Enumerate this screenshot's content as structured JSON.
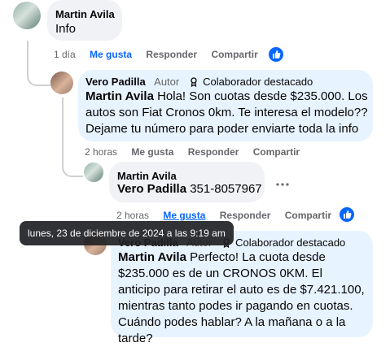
{
  "comments": [
    {
      "author": "Martin Avila",
      "text": "Info",
      "meta": {
        "time": "1 día",
        "like": "Me gusta",
        "reply": "Responder",
        "share": "Compartir"
      }
    },
    {
      "author": "Vero Padilla",
      "role": "Autor",
      "badge": "Colaborador destacado",
      "mention": "Martin Avila",
      "text": " Hola! Son cuotas desde $235.000. Los autos son Fiat Cronos 0km. Te interesa el modelo?? Dejame tu número para poder enviarte toda la info",
      "meta": {
        "time": "2 horas",
        "like": "Me gusta",
        "reply": "Responder",
        "share": "Compartir"
      }
    },
    {
      "author": "Martin Avila",
      "mention": "Vero Padilla",
      "text": " 351-8057967",
      "meta": {
        "time": "2 horas",
        "like": "Me gusta",
        "reply": "Responder",
        "share": "Compartir"
      }
    },
    {
      "author": "Vero Padilla",
      "role": "Autor",
      "badge": "Colaborador destacado",
      "mention": "Martin Avila",
      "text": " Perfecto! La cuota desde $235.000 es de un CRONOS 0KM. El anticipo para retirar el auto es de $7.421.100, mientras tanto podes ir pagando en cuotas. Cuándo podes hablar? A la mañana o a la tarde?"
    }
  ],
  "tooltip": "lunes, 23 de diciembre de 2024 a las 9:19 am",
  "icons": {
    "like": "thumbs-up-icon",
    "badge": "contributor-badge-icon",
    "more": "more-options-icon"
  },
  "colors": {
    "accent": "#0866ff",
    "bubble": "#f0f2f5",
    "highlight_bubble": "#e7f3ff",
    "meta": "#65676b"
  }
}
